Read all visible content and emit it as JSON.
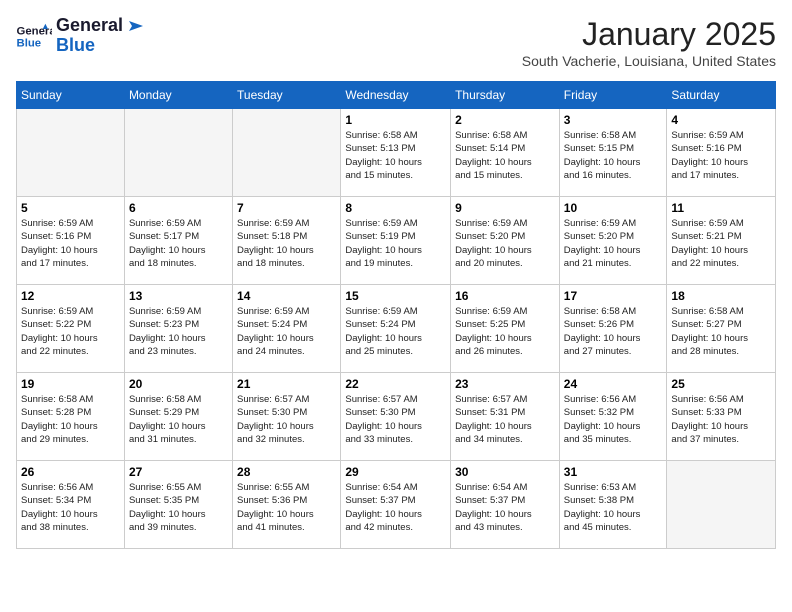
{
  "logo": {
    "general": "General",
    "blue": "Blue"
  },
  "header": {
    "month": "January 2025",
    "location": "South Vacherie, Louisiana, United States"
  },
  "weekdays": [
    "Sunday",
    "Monday",
    "Tuesday",
    "Wednesday",
    "Thursday",
    "Friday",
    "Saturday"
  ],
  "weeks": [
    [
      {
        "day": "",
        "info": ""
      },
      {
        "day": "",
        "info": ""
      },
      {
        "day": "",
        "info": ""
      },
      {
        "day": "1",
        "info": "Sunrise: 6:58 AM\nSunset: 5:13 PM\nDaylight: 10 hours\nand 15 minutes."
      },
      {
        "day": "2",
        "info": "Sunrise: 6:58 AM\nSunset: 5:14 PM\nDaylight: 10 hours\nand 15 minutes."
      },
      {
        "day": "3",
        "info": "Sunrise: 6:58 AM\nSunset: 5:15 PM\nDaylight: 10 hours\nand 16 minutes."
      },
      {
        "day": "4",
        "info": "Sunrise: 6:59 AM\nSunset: 5:16 PM\nDaylight: 10 hours\nand 17 minutes."
      }
    ],
    [
      {
        "day": "5",
        "info": "Sunrise: 6:59 AM\nSunset: 5:16 PM\nDaylight: 10 hours\nand 17 minutes."
      },
      {
        "day": "6",
        "info": "Sunrise: 6:59 AM\nSunset: 5:17 PM\nDaylight: 10 hours\nand 18 minutes."
      },
      {
        "day": "7",
        "info": "Sunrise: 6:59 AM\nSunset: 5:18 PM\nDaylight: 10 hours\nand 18 minutes."
      },
      {
        "day": "8",
        "info": "Sunrise: 6:59 AM\nSunset: 5:19 PM\nDaylight: 10 hours\nand 19 minutes."
      },
      {
        "day": "9",
        "info": "Sunrise: 6:59 AM\nSunset: 5:20 PM\nDaylight: 10 hours\nand 20 minutes."
      },
      {
        "day": "10",
        "info": "Sunrise: 6:59 AM\nSunset: 5:20 PM\nDaylight: 10 hours\nand 21 minutes."
      },
      {
        "day": "11",
        "info": "Sunrise: 6:59 AM\nSunset: 5:21 PM\nDaylight: 10 hours\nand 22 minutes."
      }
    ],
    [
      {
        "day": "12",
        "info": "Sunrise: 6:59 AM\nSunset: 5:22 PM\nDaylight: 10 hours\nand 22 minutes."
      },
      {
        "day": "13",
        "info": "Sunrise: 6:59 AM\nSunset: 5:23 PM\nDaylight: 10 hours\nand 23 minutes."
      },
      {
        "day": "14",
        "info": "Sunrise: 6:59 AM\nSunset: 5:24 PM\nDaylight: 10 hours\nand 24 minutes."
      },
      {
        "day": "15",
        "info": "Sunrise: 6:59 AM\nSunset: 5:24 PM\nDaylight: 10 hours\nand 25 minutes."
      },
      {
        "day": "16",
        "info": "Sunrise: 6:59 AM\nSunset: 5:25 PM\nDaylight: 10 hours\nand 26 minutes."
      },
      {
        "day": "17",
        "info": "Sunrise: 6:58 AM\nSunset: 5:26 PM\nDaylight: 10 hours\nand 27 minutes."
      },
      {
        "day": "18",
        "info": "Sunrise: 6:58 AM\nSunset: 5:27 PM\nDaylight: 10 hours\nand 28 minutes."
      }
    ],
    [
      {
        "day": "19",
        "info": "Sunrise: 6:58 AM\nSunset: 5:28 PM\nDaylight: 10 hours\nand 29 minutes."
      },
      {
        "day": "20",
        "info": "Sunrise: 6:58 AM\nSunset: 5:29 PM\nDaylight: 10 hours\nand 31 minutes."
      },
      {
        "day": "21",
        "info": "Sunrise: 6:57 AM\nSunset: 5:30 PM\nDaylight: 10 hours\nand 32 minutes."
      },
      {
        "day": "22",
        "info": "Sunrise: 6:57 AM\nSunset: 5:30 PM\nDaylight: 10 hours\nand 33 minutes."
      },
      {
        "day": "23",
        "info": "Sunrise: 6:57 AM\nSunset: 5:31 PM\nDaylight: 10 hours\nand 34 minutes."
      },
      {
        "day": "24",
        "info": "Sunrise: 6:56 AM\nSunset: 5:32 PM\nDaylight: 10 hours\nand 35 minutes."
      },
      {
        "day": "25",
        "info": "Sunrise: 6:56 AM\nSunset: 5:33 PM\nDaylight: 10 hours\nand 37 minutes."
      }
    ],
    [
      {
        "day": "26",
        "info": "Sunrise: 6:56 AM\nSunset: 5:34 PM\nDaylight: 10 hours\nand 38 minutes."
      },
      {
        "day": "27",
        "info": "Sunrise: 6:55 AM\nSunset: 5:35 PM\nDaylight: 10 hours\nand 39 minutes."
      },
      {
        "day": "28",
        "info": "Sunrise: 6:55 AM\nSunset: 5:36 PM\nDaylight: 10 hours\nand 41 minutes."
      },
      {
        "day": "29",
        "info": "Sunrise: 6:54 AM\nSunset: 5:37 PM\nDaylight: 10 hours\nand 42 minutes."
      },
      {
        "day": "30",
        "info": "Sunrise: 6:54 AM\nSunset: 5:37 PM\nDaylight: 10 hours\nand 43 minutes."
      },
      {
        "day": "31",
        "info": "Sunrise: 6:53 AM\nSunset: 5:38 PM\nDaylight: 10 hours\nand 45 minutes."
      },
      {
        "day": "",
        "info": ""
      }
    ]
  ]
}
